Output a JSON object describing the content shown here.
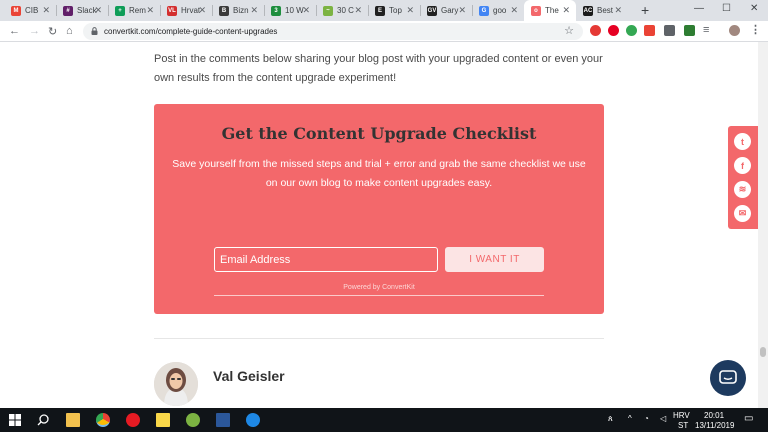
{
  "browser": {
    "tabs": [
      {
        "title": "CIB",
        "fav": "M",
        "color": "#ea4335"
      },
      {
        "title": "Slack",
        "fav": "#",
        "color": "#611f69"
      },
      {
        "title": "Rem",
        "fav": "+",
        "color": "#0f9d58"
      },
      {
        "title": "Hrvat",
        "fav": "VL",
        "color": "#d32f2f"
      },
      {
        "title": "Bizn",
        "fav": "B",
        "color": "#3b3b3b"
      },
      {
        "title": "10 W",
        "fav": "3",
        "color": "#1e8e3e"
      },
      {
        "title": "30 C",
        "fav": "~",
        "color": "#7cb342"
      },
      {
        "title": "Top",
        "fav": "E",
        "color": "#212121"
      },
      {
        "title": "Gary",
        "fav": "GV",
        "color": "#222222"
      },
      {
        "title": "goo",
        "fav": "G",
        "color": "#4285f4"
      },
      {
        "title": "The",
        "fav": "o",
        "color": "#f3686b",
        "active": true
      },
      {
        "title": "Best",
        "fav": "AC",
        "color": "#1a1a1a"
      }
    ],
    "url": "convertkit.com/complete-guide-content-upgrades",
    "new_tab_glyph": "+",
    "window_controls": {
      "minimize": "—",
      "maximize": "☐",
      "close": "✕"
    }
  },
  "article": {
    "intro": "Post in the comments below sharing your blog post with your upgraded content or even your own results from the content upgrade experiment!"
  },
  "optin": {
    "title": "Get the Content Upgrade Checklist",
    "description": "Save yourself from the missed steps and trial + error and grab the same checklist we use on our own blog to make content upgrades easy.",
    "email_placeholder": "Email Address",
    "submit_label": "I WANT IT",
    "powered_by": "Powered by ConvertKit",
    "background_color": "#f3686b"
  },
  "author": {
    "name": "Val Geisler"
  },
  "share": {
    "icons": [
      "twitter-icon",
      "facebook-icon",
      "buffer-icon",
      "email-icon"
    ]
  },
  "taskbar": {
    "lang": "HRV",
    "lang2": "ST",
    "time": "20:01",
    "date": "13/11/2019"
  }
}
